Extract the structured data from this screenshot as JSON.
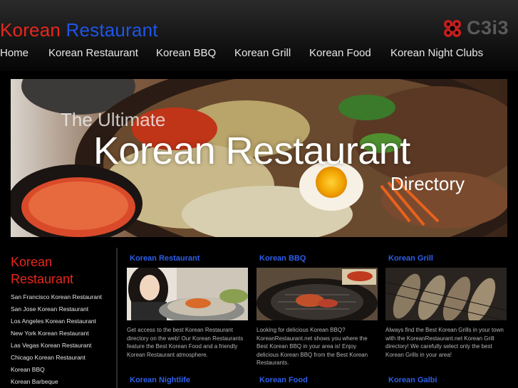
{
  "header": {
    "title_part1": "Korean",
    "title_part2": "Restaurant",
    "brand_text": "C3i3",
    "brand_icon": "c3i3-logo-icon"
  },
  "nav": {
    "items": [
      "Home",
      "Korean Restaurant",
      "Korean BBQ",
      "Korean Grill",
      "Korean Food",
      "Korean Night Clubs"
    ]
  },
  "hero": {
    "line1": "The Ultimate",
    "line2": "Korean Restaurant",
    "line3": "Directory"
  },
  "sidebar": {
    "title": "Korean Restaurant",
    "links": [
      "San Francisco Korean Restaurant",
      "San Jose Korean Restaurant",
      "Los Angeles Korean Restaurant",
      "New York Korean Restaurant",
      "Las Vegas Korean Restaurant",
      "Chicago Korean Restaurant",
      "Korean BBQ",
      "Korean Barbeque"
    ]
  },
  "cards": [
    {
      "title": "Korean Restaurant",
      "text": "Get access to the best Korean Restaurant directory on the web! Our Korean Restaurants feature the Best Korean Food and a friendly Korean Restaurant atmosphere."
    },
    {
      "title": "Korean BBQ",
      "text": "Looking for delicious Korean BBQ? KoreanRestaurant.net shows you where the Best Korean BBQ in your area is! Enjoy delicious Korean BBQ from the Best Korean Restaurants."
    },
    {
      "title": "Korean Grill",
      "text": "Always find the Best Korean Grills in your town with the KoreanRestaurant.net Korean Grill directory! We carefully select only the best Korean Grills in your area!"
    },
    {
      "title": "Korean Nightlife"
    },
    {
      "title": "Korean Food"
    },
    {
      "title": "Korean Galbi"
    }
  ],
  "colors": {
    "accent_red": "#e8271c",
    "accent_blue": "#1f55e8",
    "link_blue": "#2d5ee8",
    "background": "#000000"
  }
}
